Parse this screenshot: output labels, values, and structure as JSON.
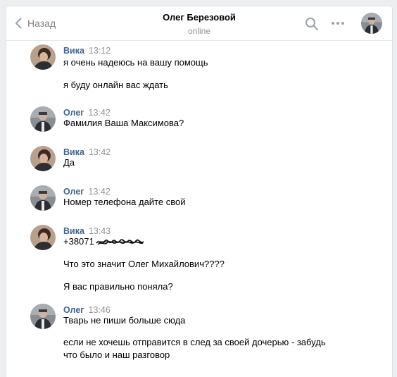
{
  "header": {
    "back_label": "Назад",
    "title": "Олег Березовой",
    "status": "online"
  },
  "icons": {
    "back": "chevron-left-icon",
    "search": "search-icon",
    "more": "more-horizontal-icon"
  },
  "colors": {
    "author": "#42648b",
    "time": "#939393",
    "back": "#828282",
    "divider": "#e7e8ec"
  },
  "messages": [
    {
      "author": "Вика",
      "time": "13:12",
      "lines": [
        "я очень надеюсь на вашу помощь",
        "я буду онлайн вас ждать"
      ]
    },
    {
      "author": "Олег",
      "time": "13:42",
      "lines": [
        "Фамилия Ваша Максимова?"
      ]
    },
    {
      "author": "Вика",
      "time": "13:42",
      "lines": [
        "Да"
      ]
    },
    {
      "author": "Олег",
      "time": "13:42",
      "lines": [
        "Номер телефона дайте свой"
      ]
    },
    {
      "author": "Вика",
      "time": "13:43",
      "lines": [
        "+38071",
        "Что это значит Олег Михайлович????",
        "Я вас правильно поняла?"
      ]
    },
    {
      "author": "Олег",
      "time": "13:46",
      "lines": [
        "Тварь не пиши больше сюда",
        "если не хочешь отправится в след за своей дочерью - забудь",
        "что было и наш разговор"
      ]
    }
  ]
}
